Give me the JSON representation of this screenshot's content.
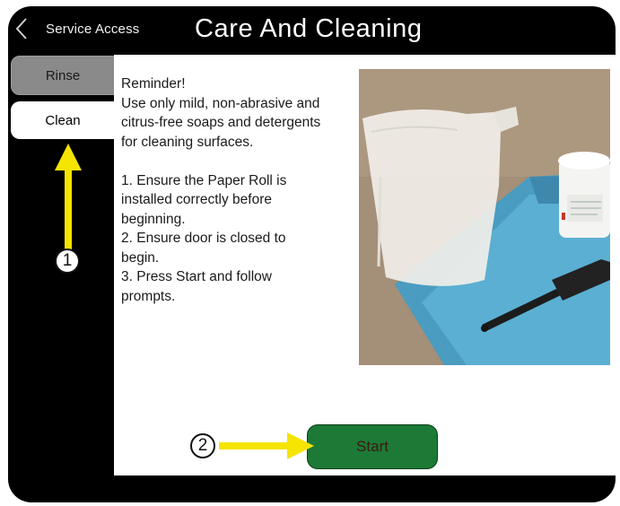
{
  "header": {
    "back_label": "Service Access",
    "title": "Care And Cleaning"
  },
  "tabs": [
    {
      "label": "Rinse",
      "active": false
    },
    {
      "label": "Clean",
      "active": true
    }
  ],
  "instructions": {
    "lines": [
      "Reminder!",
      "Use only mild, non-abrasive and",
      "citrus-free soaps and detergents",
      "for cleaning surfaces.",
      "",
      "1. Ensure the Paper Roll is",
      "installed correctly before",
      "beginning.",
      "2. Ensure door is closed to",
      "begin.",
      "3. Press Start and follow",
      "prompts."
    ]
  },
  "start_button": {
    "label": "Start"
  },
  "annotations": {
    "callout_1": "1",
    "callout_2": "2"
  },
  "colors": {
    "device_bezel": "#000000",
    "start_button": "#1c7a36",
    "arrow": "#f5e400",
    "inactive_tab": "#8a8a8a"
  }
}
